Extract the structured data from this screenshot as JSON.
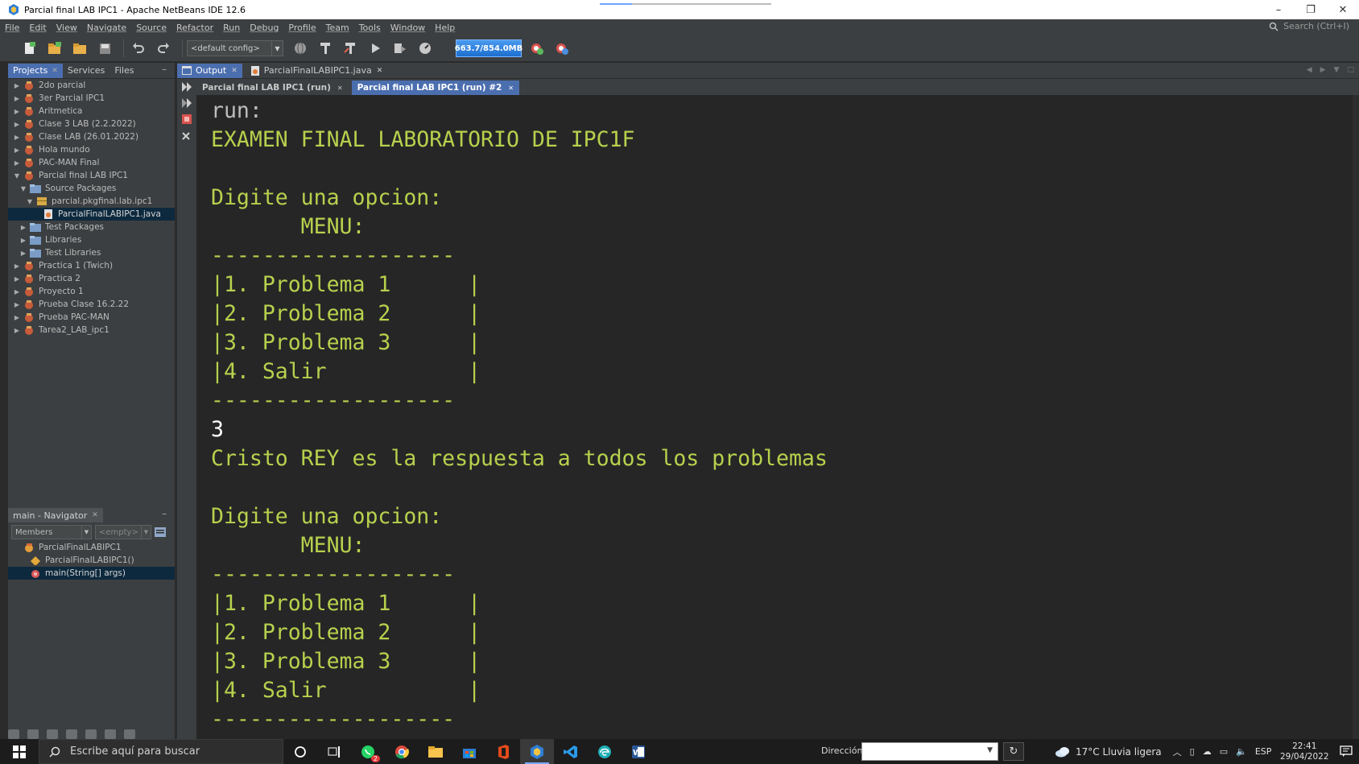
{
  "window": {
    "title": "Parcial final LAB IPC1 - Apache NetBeans IDE 12.6",
    "controls": [
      "–",
      "❐",
      "✕"
    ]
  },
  "menu": {
    "items": [
      "File",
      "Edit",
      "View",
      "Navigate",
      "Source",
      "Refactor",
      "Run",
      "Debug",
      "Profile",
      "Team",
      "Tools",
      "Window",
      "Help"
    ],
    "search_placeholder": "Search (Ctrl+I)"
  },
  "toolbar": {
    "config": "<default config>",
    "memory_label": "663.7/854.0MB"
  },
  "projects_panel": {
    "tabs": [
      "Projects",
      "Services",
      "Files"
    ],
    "tree": [
      {
        "label": "2do parcial",
        "depth": 0,
        "expanded": false,
        "type": "project"
      },
      {
        "label": "3er Parcial IPC1",
        "depth": 0,
        "expanded": false,
        "type": "project"
      },
      {
        "label": "Aritmetica",
        "depth": 0,
        "expanded": false,
        "type": "project"
      },
      {
        "label": "Clase 3 LAB (2.2.2022)",
        "depth": 0,
        "expanded": false,
        "type": "project"
      },
      {
        "label": "Clase LAB (26.01.2022)",
        "depth": 0,
        "expanded": false,
        "type": "project"
      },
      {
        "label": "Hola mundo",
        "depth": 0,
        "expanded": false,
        "type": "project"
      },
      {
        "label": "PAC-MAN Final",
        "depth": 0,
        "expanded": false,
        "type": "project"
      },
      {
        "label": "Parcial final LAB IPC1",
        "depth": 0,
        "expanded": true,
        "type": "project"
      },
      {
        "label": "Source Packages",
        "depth": 1,
        "expanded": true,
        "type": "folder"
      },
      {
        "label": "parcial.pkgfinal.lab.ipc1",
        "depth": 2,
        "expanded": true,
        "type": "package"
      },
      {
        "label": "ParcialFinalLABIPC1.java",
        "depth": 3,
        "expanded": null,
        "type": "java",
        "selected": true
      },
      {
        "label": "Test Packages",
        "depth": 1,
        "expanded": false,
        "type": "folder"
      },
      {
        "label": "Libraries",
        "depth": 1,
        "expanded": false,
        "type": "folder"
      },
      {
        "label": "Test Libraries",
        "depth": 1,
        "expanded": false,
        "type": "folder"
      },
      {
        "label": "Practica 1 (Twich)",
        "depth": 0,
        "expanded": false,
        "type": "project"
      },
      {
        "label": "Practica 2",
        "depth": 0,
        "expanded": false,
        "type": "project"
      },
      {
        "label": "Proyecto 1",
        "depth": 0,
        "expanded": false,
        "type": "project"
      },
      {
        "label": "Prueba Clase 16.2.22",
        "depth": 0,
        "expanded": false,
        "type": "project"
      },
      {
        "label": "Prueba PAC-MAN",
        "depth": 0,
        "expanded": false,
        "type": "project"
      },
      {
        "label": "Tarea2_LAB_ipc1",
        "depth": 0,
        "expanded": false,
        "type": "project"
      }
    ]
  },
  "navigator": {
    "title": "main - Navigator",
    "filter1": "Members",
    "filter2": "<empty>",
    "tree": [
      {
        "label": "ParcialFinalLABIPC1",
        "depth": 0,
        "type": "class"
      },
      {
        "label": "ParcialFinalLABIPC1()",
        "depth": 1,
        "type": "constructor"
      },
      {
        "label": "main(String[] args)",
        "depth": 1,
        "type": "method",
        "selected": true
      }
    ]
  },
  "output": {
    "window_tabs": [
      "Output",
      "ParcialFinalLABIPC1.java"
    ],
    "run_tabs": [
      "Parcial final LAB IPC1 (run)",
      "Parcial final LAB IPC1 (run) #2"
    ],
    "lines": [
      {
        "text": "run:",
        "kind": "run"
      },
      {
        "text": "EXAMEN FINAL LABORATORIO DE IPC1F",
        "kind": "out"
      },
      {
        "text": "",
        "kind": "out"
      },
      {
        "text": "Digite una opcion:",
        "kind": "out"
      },
      {
        "text": "       MENU:",
        "kind": "out"
      },
      {
        "text": "-------------------",
        "kind": "out"
      },
      {
        "text": "|1. Problema 1      |",
        "kind": "out"
      },
      {
        "text": "|2. Problema 2      |",
        "kind": "out"
      },
      {
        "text": "|3. Problema 3      |",
        "kind": "out"
      },
      {
        "text": "|4. Salir           |",
        "kind": "out"
      },
      {
        "text": "-------------------",
        "kind": "out"
      },
      {
        "text": "3",
        "kind": "input"
      },
      {
        "text": "Cristo REY es la respuesta a todos los problemas",
        "kind": "out"
      },
      {
        "text": "",
        "kind": "out"
      },
      {
        "text": "Digite una opcion:",
        "kind": "out"
      },
      {
        "text": "       MENU:",
        "kind": "out"
      },
      {
        "text": "-------------------",
        "kind": "out"
      },
      {
        "text": "|1. Problema 1      |",
        "kind": "out"
      },
      {
        "text": "|2. Problema 2      |",
        "kind": "out"
      },
      {
        "text": "|3. Problema 3      |",
        "kind": "out"
      },
      {
        "text": "|4. Salir           |",
        "kind": "out"
      },
      {
        "text": "-------------------",
        "kind": "out"
      }
    ]
  },
  "taskbar": {
    "search_placeholder": "Escribe aquí para buscar",
    "whatsapp_badge": "2",
    "address_label": "Dirección",
    "weather": "17°C  Lluvia ligera",
    "language": "ESP",
    "time": "22:41",
    "date": "29/04/2022"
  },
  "colors": {
    "console_text": "#b7d14d",
    "console_bg": "#262626",
    "accent_tab": "#4b6eaf"
  }
}
